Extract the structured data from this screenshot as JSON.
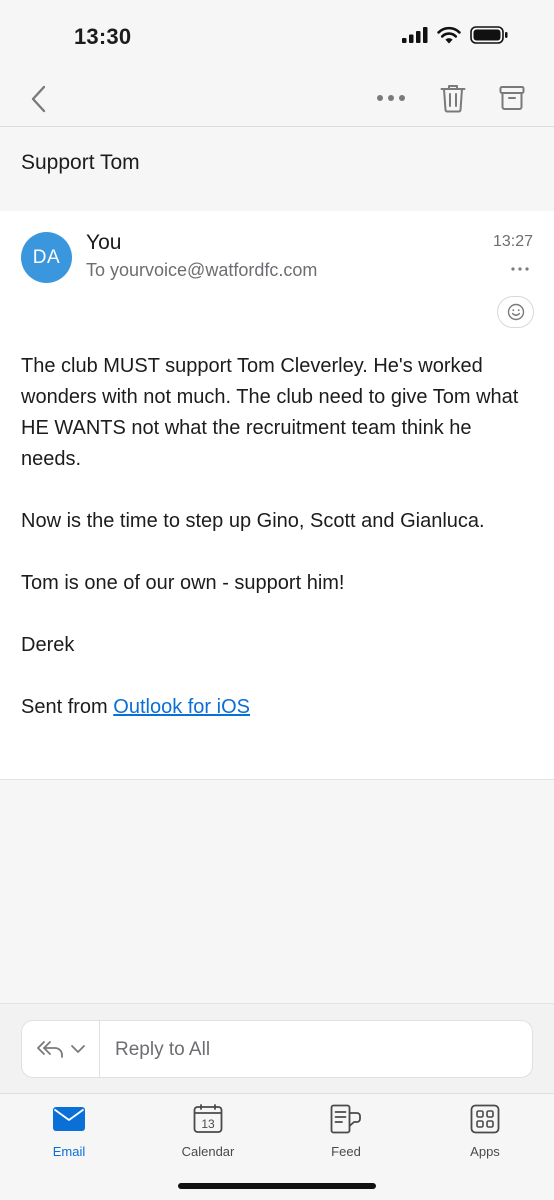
{
  "status_bar": {
    "time": "13:30"
  },
  "header": {
    "subject": "Support Tom"
  },
  "message": {
    "avatar_initials": "DA",
    "sender": "You",
    "recipient": "To yourvoice@watfordfc.com",
    "time": "13:27",
    "body": [
      "The club MUST support Tom Cleverley. He's worked wonders with not much. The club need to give Tom what HE WANTS not what the recruitment team think he needs.",
      "Now is the time to step up Gino, Scott and Gianluca.",
      "Tom is one of our own - support him!",
      "Derek"
    ],
    "signature_prefix": "Sent from ",
    "signature_link": "Outlook for iOS"
  },
  "reply": {
    "placeholder": "Reply to All"
  },
  "tabs": {
    "email": "Email",
    "calendar": "Calendar",
    "calendar_day": "13",
    "feed": "Feed",
    "apps": "Apps"
  },
  "colors": {
    "accent": "#0a6fd6",
    "avatar": "#3a96dd"
  },
  "icons": [
    "back-chevron-icon",
    "more-icon",
    "trash-icon",
    "archive-icon",
    "emoji-icon",
    "reply-all-icon",
    "chevron-down-icon",
    "mail-icon",
    "calendar-icon",
    "feed-icon",
    "apps-icon"
  ]
}
